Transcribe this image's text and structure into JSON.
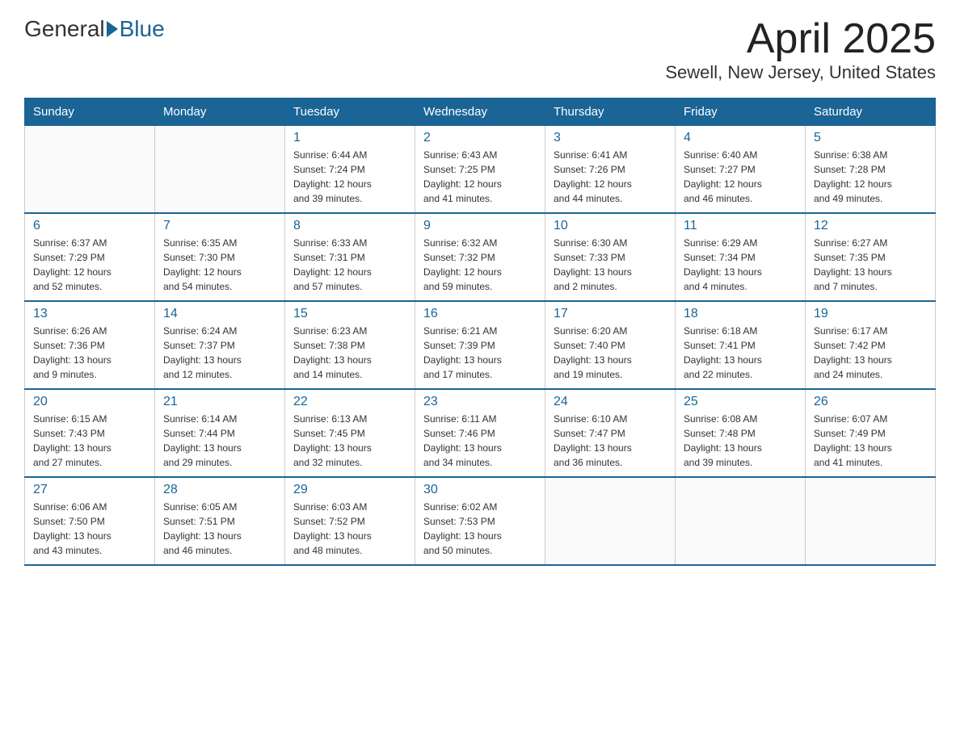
{
  "header": {
    "logo_general": "General",
    "logo_blue": "Blue",
    "month_title": "April 2025",
    "location": "Sewell, New Jersey, United States"
  },
  "days_of_week": [
    "Sunday",
    "Monday",
    "Tuesday",
    "Wednesday",
    "Thursday",
    "Friday",
    "Saturday"
  ],
  "weeks": [
    [
      {
        "num": "",
        "info": ""
      },
      {
        "num": "",
        "info": ""
      },
      {
        "num": "1",
        "info": "Sunrise: 6:44 AM\nSunset: 7:24 PM\nDaylight: 12 hours\nand 39 minutes."
      },
      {
        "num": "2",
        "info": "Sunrise: 6:43 AM\nSunset: 7:25 PM\nDaylight: 12 hours\nand 41 minutes."
      },
      {
        "num": "3",
        "info": "Sunrise: 6:41 AM\nSunset: 7:26 PM\nDaylight: 12 hours\nand 44 minutes."
      },
      {
        "num": "4",
        "info": "Sunrise: 6:40 AM\nSunset: 7:27 PM\nDaylight: 12 hours\nand 46 minutes."
      },
      {
        "num": "5",
        "info": "Sunrise: 6:38 AM\nSunset: 7:28 PM\nDaylight: 12 hours\nand 49 minutes."
      }
    ],
    [
      {
        "num": "6",
        "info": "Sunrise: 6:37 AM\nSunset: 7:29 PM\nDaylight: 12 hours\nand 52 minutes."
      },
      {
        "num": "7",
        "info": "Sunrise: 6:35 AM\nSunset: 7:30 PM\nDaylight: 12 hours\nand 54 minutes."
      },
      {
        "num": "8",
        "info": "Sunrise: 6:33 AM\nSunset: 7:31 PM\nDaylight: 12 hours\nand 57 minutes."
      },
      {
        "num": "9",
        "info": "Sunrise: 6:32 AM\nSunset: 7:32 PM\nDaylight: 12 hours\nand 59 minutes."
      },
      {
        "num": "10",
        "info": "Sunrise: 6:30 AM\nSunset: 7:33 PM\nDaylight: 13 hours\nand 2 minutes."
      },
      {
        "num": "11",
        "info": "Sunrise: 6:29 AM\nSunset: 7:34 PM\nDaylight: 13 hours\nand 4 minutes."
      },
      {
        "num": "12",
        "info": "Sunrise: 6:27 AM\nSunset: 7:35 PM\nDaylight: 13 hours\nand 7 minutes."
      }
    ],
    [
      {
        "num": "13",
        "info": "Sunrise: 6:26 AM\nSunset: 7:36 PM\nDaylight: 13 hours\nand 9 minutes."
      },
      {
        "num": "14",
        "info": "Sunrise: 6:24 AM\nSunset: 7:37 PM\nDaylight: 13 hours\nand 12 minutes."
      },
      {
        "num": "15",
        "info": "Sunrise: 6:23 AM\nSunset: 7:38 PM\nDaylight: 13 hours\nand 14 minutes."
      },
      {
        "num": "16",
        "info": "Sunrise: 6:21 AM\nSunset: 7:39 PM\nDaylight: 13 hours\nand 17 minutes."
      },
      {
        "num": "17",
        "info": "Sunrise: 6:20 AM\nSunset: 7:40 PM\nDaylight: 13 hours\nand 19 minutes."
      },
      {
        "num": "18",
        "info": "Sunrise: 6:18 AM\nSunset: 7:41 PM\nDaylight: 13 hours\nand 22 minutes."
      },
      {
        "num": "19",
        "info": "Sunrise: 6:17 AM\nSunset: 7:42 PM\nDaylight: 13 hours\nand 24 minutes."
      }
    ],
    [
      {
        "num": "20",
        "info": "Sunrise: 6:15 AM\nSunset: 7:43 PM\nDaylight: 13 hours\nand 27 minutes."
      },
      {
        "num": "21",
        "info": "Sunrise: 6:14 AM\nSunset: 7:44 PM\nDaylight: 13 hours\nand 29 minutes."
      },
      {
        "num": "22",
        "info": "Sunrise: 6:13 AM\nSunset: 7:45 PM\nDaylight: 13 hours\nand 32 minutes."
      },
      {
        "num": "23",
        "info": "Sunrise: 6:11 AM\nSunset: 7:46 PM\nDaylight: 13 hours\nand 34 minutes."
      },
      {
        "num": "24",
        "info": "Sunrise: 6:10 AM\nSunset: 7:47 PM\nDaylight: 13 hours\nand 36 minutes."
      },
      {
        "num": "25",
        "info": "Sunrise: 6:08 AM\nSunset: 7:48 PM\nDaylight: 13 hours\nand 39 minutes."
      },
      {
        "num": "26",
        "info": "Sunrise: 6:07 AM\nSunset: 7:49 PM\nDaylight: 13 hours\nand 41 minutes."
      }
    ],
    [
      {
        "num": "27",
        "info": "Sunrise: 6:06 AM\nSunset: 7:50 PM\nDaylight: 13 hours\nand 43 minutes."
      },
      {
        "num": "28",
        "info": "Sunrise: 6:05 AM\nSunset: 7:51 PM\nDaylight: 13 hours\nand 46 minutes."
      },
      {
        "num": "29",
        "info": "Sunrise: 6:03 AM\nSunset: 7:52 PM\nDaylight: 13 hours\nand 48 minutes."
      },
      {
        "num": "30",
        "info": "Sunrise: 6:02 AM\nSunset: 7:53 PM\nDaylight: 13 hours\nand 50 minutes."
      },
      {
        "num": "",
        "info": ""
      },
      {
        "num": "",
        "info": ""
      },
      {
        "num": "",
        "info": ""
      }
    ]
  ]
}
